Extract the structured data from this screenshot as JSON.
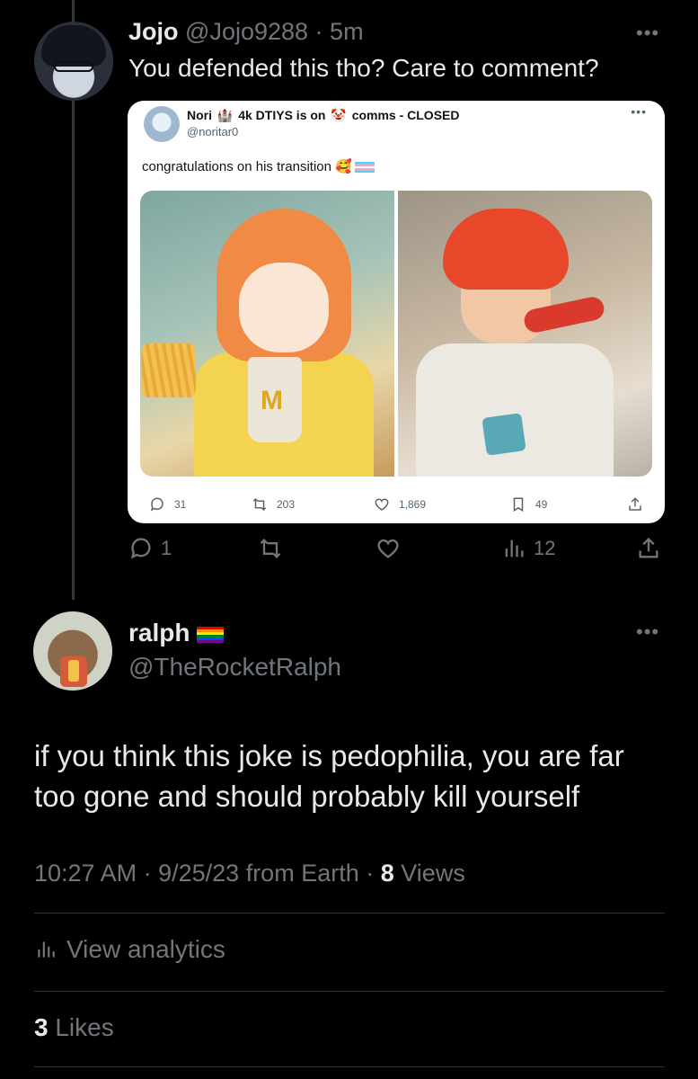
{
  "reply": {
    "name": "Jojo",
    "handle": "@Jojo9288",
    "time": "5m",
    "text": "You defended this tho? Care to comment?",
    "actions": {
      "replies": "1",
      "views": "12"
    }
  },
  "embedded": {
    "name_part1": "Nori",
    "name_part2": "4k DTIYS is on",
    "name_part3": "comms - CLOSED",
    "handle": "@noritar0",
    "text": "congratulations on his transition",
    "stats": {
      "replies": "31",
      "retweets": "203",
      "likes": "1,869",
      "bookmarks": "49"
    }
  },
  "tweet": {
    "name": "ralph",
    "handle": "@TheRocketRalph",
    "text": "if you think this joke is pedophilia, you are far too gone and should probably kill yourself",
    "time": "10:27 AM",
    "date": "9/25/23",
    "source": "from Earth",
    "views_count": "8",
    "views_label": "Views",
    "analytics_label": "View analytics",
    "likes_count": "3",
    "likes_label": "Likes"
  },
  "icons": [
    "reply-icon",
    "retweet-icon",
    "like-icon",
    "views-icon",
    "share-icon",
    "bookmark-icon",
    "more-icon",
    "pride-flag-icon",
    "trans-flag-icon"
  ],
  "colors": {
    "background": "#000000",
    "text": "#e7e9ea",
    "muted": "#71767b",
    "divider": "#2f3336"
  }
}
